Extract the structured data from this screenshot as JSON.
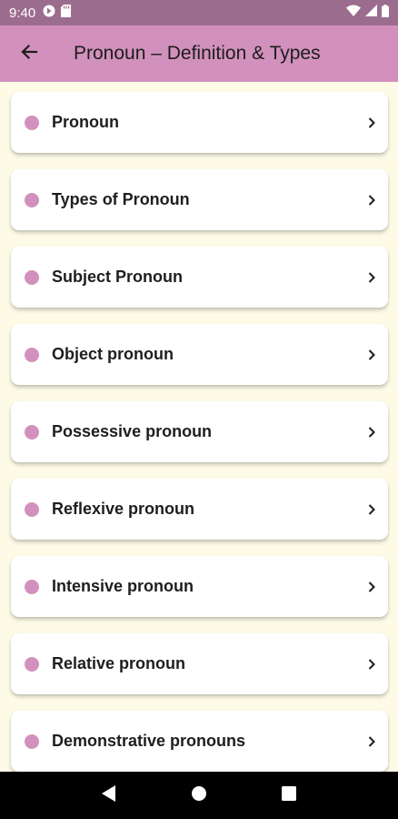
{
  "status_bar": {
    "time": "9:40",
    "left_icons": [
      "data-saver-icon",
      "sd-card-icon"
    ],
    "right_icons": [
      "wifi-icon",
      "signal-icon",
      "battery-icon"
    ]
  },
  "app_bar": {
    "title": "Pronoun – Definition & Types",
    "back_icon": "arrow-left-icon"
  },
  "list": {
    "items": [
      {
        "label": "Pronoun"
      },
      {
        "label": "Types of Pronoun"
      },
      {
        "label": "Subject Pronoun"
      },
      {
        "label": "Object pronoun"
      },
      {
        "label": "Possessive pronoun"
      },
      {
        "label": "Reflexive pronoun"
      },
      {
        "label": "Intensive pronoun"
      },
      {
        "label": "Relative pronoun"
      },
      {
        "label": "Demonstrative pronouns"
      }
    ],
    "item_icon": "bullet-dot-icon",
    "trailing_icon": "chevron-right-icon"
  },
  "nav_bar": {
    "buttons": [
      "back-triangle-icon",
      "home-circle-icon",
      "recents-square-icon"
    ]
  },
  "colors": {
    "status_bar": "#9c6c8e",
    "app_bar": "#d291bd",
    "background": "#fdfbe6",
    "card": "#ffffff",
    "accent_dot": "#d291bd"
  }
}
